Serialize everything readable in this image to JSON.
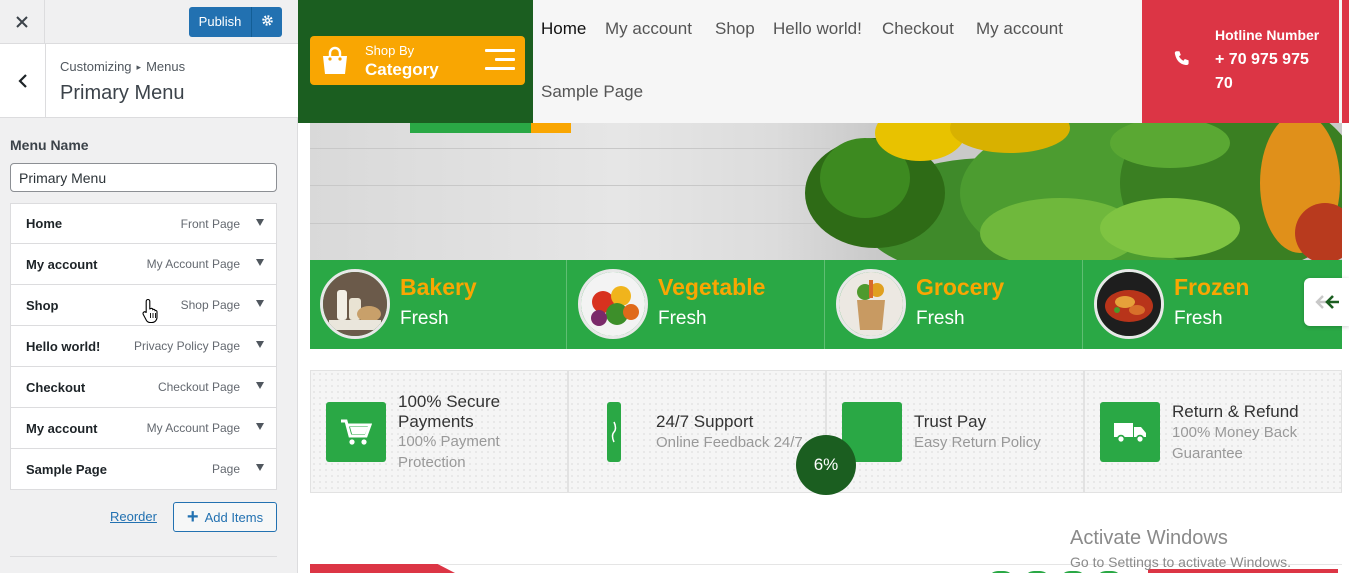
{
  "customizer": {
    "close_icon": "close-icon",
    "publish_label": "Publish",
    "breadcrumb_root": "Customizing",
    "breadcrumb_sep": "▸",
    "breadcrumb_leaf": "Menus",
    "panel_title": "Primary Menu",
    "menu_name_label": "Menu Name",
    "menu_name_value": "Primary Menu",
    "items": [
      {
        "title": "Home",
        "type": "Front Page"
      },
      {
        "title": "My account",
        "type": "My Account Page"
      },
      {
        "title": "Shop",
        "type": "Shop Page"
      },
      {
        "title": "Hello world!",
        "type": "Privacy Policy Page"
      },
      {
        "title": "Checkout",
        "type": "Checkout Page"
      },
      {
        "title": "My account",
        "type": "My Account Page"
      },
      {
        "title": "Sample Page",
        "type": "Page"
      }
    ],
    "reorder_label": "Reorder",
    "add_items_label": "Add Items",
    "accent_color": "#2271b1"
  },
  "site": {
    "shop_by_line1": "Shop By",
    "shop_by_line2": "Category",
    "nav": [
      "Home",
      "My account",
      "Shop",
      "Hello world!",
      "Checkout",
      "My account",
      "Sample Page"
    ],
    "hotline_label": "Hotline Number",
    "hotline_number": "+ 70 975 975 70",
    "categories": [
      {
        "name": "Bakery",
        "sub": "Fresh"
      },
      {
        "name": "Vegetable",
        "sub": "Fresh"
      },
      {
        "name": "Grocery",
        "sub": "Fresh"
      },
      {
        "name": "Frozen",
        "sub": "Fresh"
      }
    ],
    "features": [
      {
        "title": "100% Secure Payments",
        "desc": "100% Payment Protection",
        "icon": "cart-icon"
      },
      {
        "title": "24/7 Support",
        "desc": "Online Feedback 24/7",
        "icon": "support-icon"
      },
      {
        "title": "Trust Pay",
        "desc": "Easy Return Policy",
        "icon": "trust-pay-icon"
      },
      {
        "title": "Return & Refund",
        "desc": "100% Money Back Guarantee",
        "icon": "truck-icon"
      }
    ],
    "progress_label": "6%",
    "colors": {
      "green_dark": "#1b5e20",
      "green": "#2aa845",
      "orange": "#f9a602",
      "red": "#dc3545"
    }
  },
  "watermark": {
    "line1": "Activate Windows",
    "line2": "Go to Settings to activate Windows."
  }
}
